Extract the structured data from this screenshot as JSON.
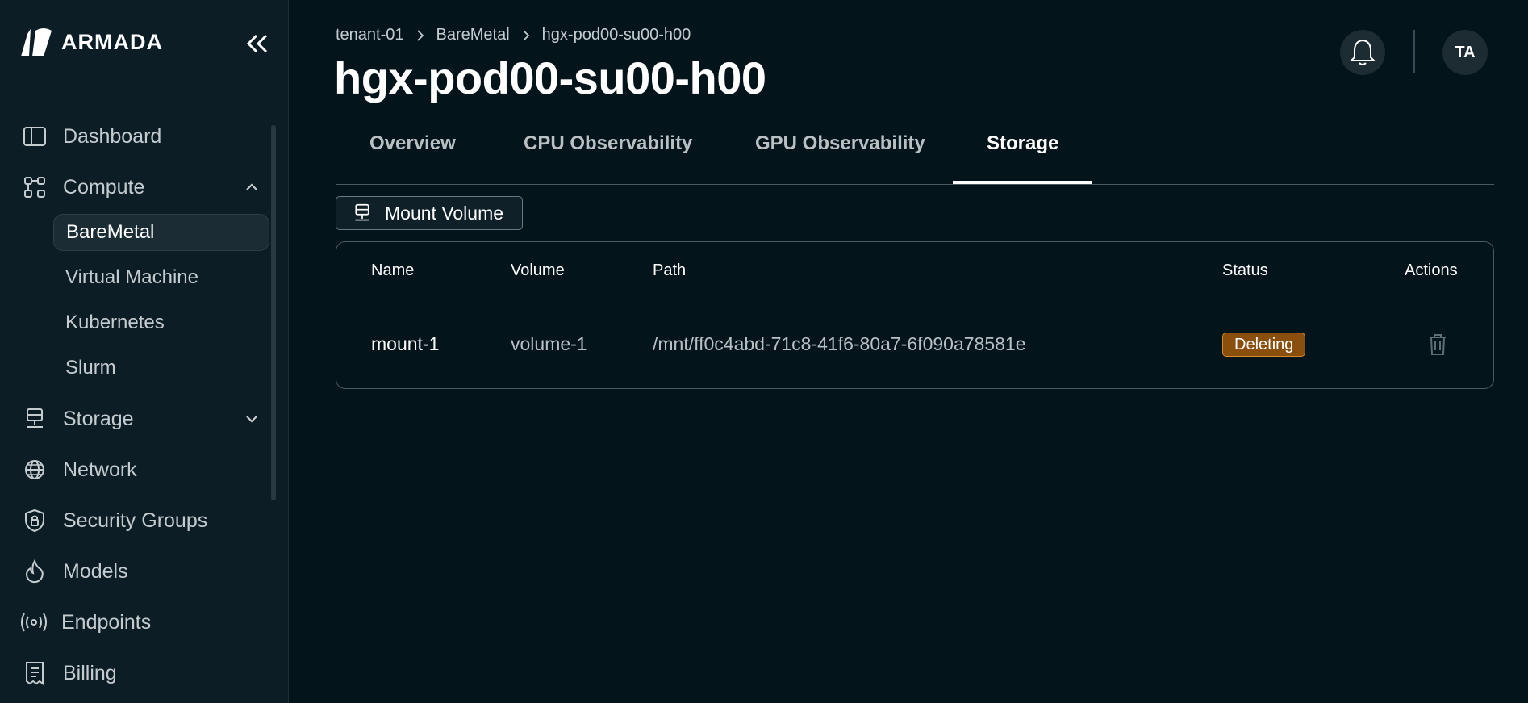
{
  "app": {
    "brand": "ARMADA"
  },
  "sidebar": {
    "items": [
      {
        "label": "Dashboard",
        "icon": "sidebar-panel-icon"
      },
      {
        "label": "Compute",
        "icon": "nodes-icon",
        "expanded": true,
        "children": [
          {
            "label": "BareMetal",
            "active": true
          },
          {
            "label": "Virtual Machine"
          },
          {
            "label": "Kubernetes"
          },
          {
            "label": "Slurm"
          }
        ]
      },
      {
        "label": "Storage",
        "icon": "server-icon",
        "expanded": false
      },
      {
        "label": "Network",
        "icon": "globe-icon"
      },
      {
        "label": "Security Groups",
        "icon": "shield-lock-icon"
      },
      {
        "label": "Models",
        "icon": "flame-icon"
      },
      {
        "label": "Endpoints",
        "icon": "broadcast-icon"
      },
      {
        "label": "Billing",
        "icon": "receipt-icon"
      }
    ]
  },
  "breadcrumb": [
    "tenant-01",
    "BareMetal",
    "hgx-pod00-su00-h00"
  ],
  "page": {
    "title": "hgx-pod00-su00-h00"
  },
  "header": {
    "avatar_initials": "TA"
  },
  "tabs": [
    {
      "label": "Overview"
    },
    {
      "label": "CPU Observability"
    },
    {
      "label": "GPU Observability"
    },
    {
      "label": "Storage",
      "active": true
    }
  ],
  "toolbar": {
    "mount_volume_label": "Mount Volume"
  },
  "table": {
    "columns": [
      "Name",
      "Volume",
      "Path",
      "Status",
      "Actions"
    ],
    "rows": [
      {
        "name": "mount-1",
        "volume": "volume-1",
        "path": "/mnt/ff0c4abd-71c8-41f6-80a7-6f090a78581e",
        "status": "Deleting"
      }
    ]
  },
  "colors": {
    "background": "#04141b",
    "sidebar": "#0d1d25",
    "status_deleting": "#8a4f0d"
  }
}
